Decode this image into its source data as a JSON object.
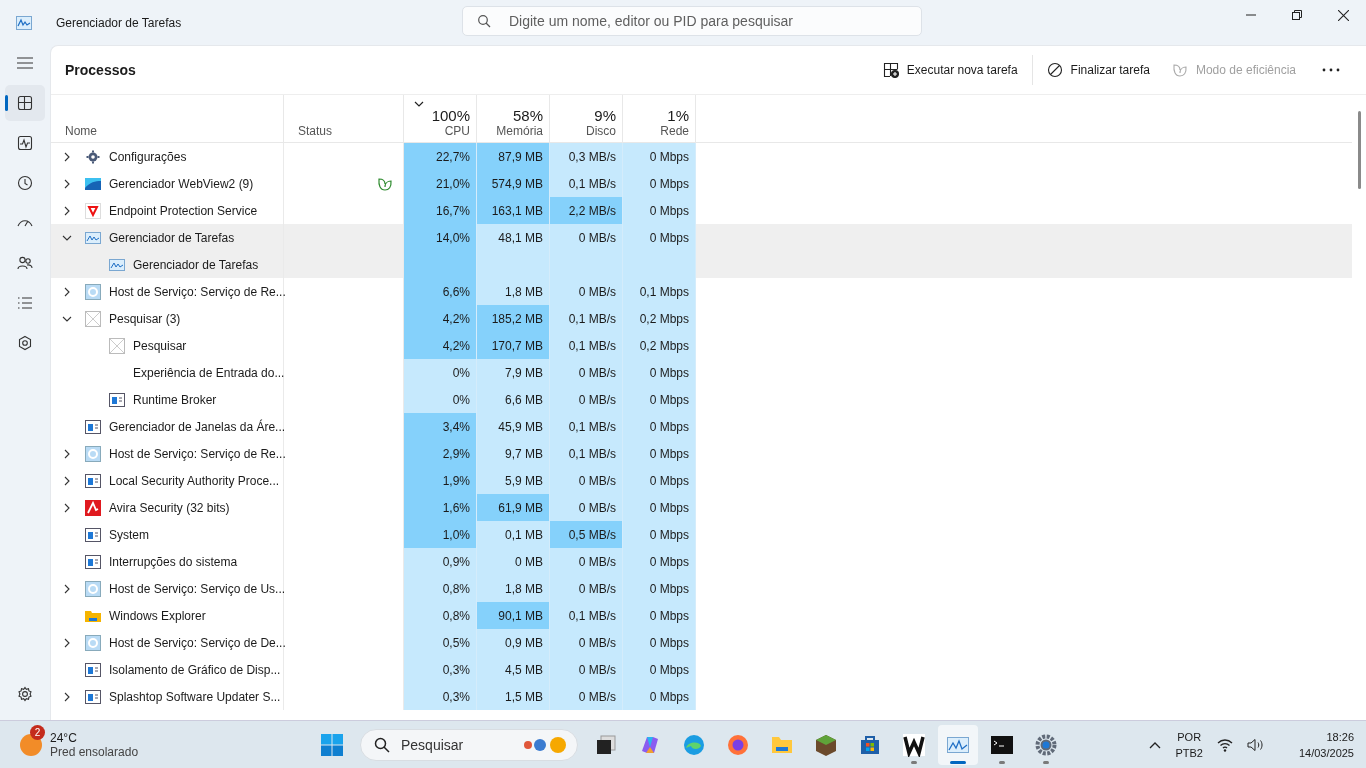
{
  "window": {
    "title": "Gerenciador de Tarefas"
  },
  "search": {
    "placeholder": "Digite um nome, editor ou PID para pesquisar"
  },
  "sidebar": {
    "items": [
      {
        "kind": "processes",
        "selected": true
      },
      {
        "kind": "performance",
        "selected": false
      },
      {
        "kind": "history",
        "selected": false
      },
      {
        "kind": "startup",
        "selected": false
      },
      {
        "kind": "users",
        "selected": false
      },
      {
        "kind": "details",
        "selected": false
      },
      {
        "kind": "services",
        "selected": false
      }
    ]
  },
  "page": {
    "title": "Processos"
  },
  "toolbar": [
    {
      "kind": "run",
      "label": "Executar nova tarefa",
      "disabled": false
    },
    {
      "kind": "end",
      "label": "Finalizar tarefa",
      "disabled": false
    },
    {
      "kind": "eco",
      "label": "Modo de eficiência",
      "disabled": true
    }
  ],
  "columns": [
    {
      "label": "Nome",
      "sorted": false
    },
    {
      "label": "Status",
      "sorted": false
    },
    {
      "total": "100%",
      "label": "CPU",
      "sorted": true
    },
    {
      "total": "58%",
      "label": "Memória",
      "sorted": false
    },
    {
      "total": "9%",
      "label": "Disco",
      "sorted": false
    },
    {
      "total": "1%",
      "label": "Rede",
      "sorted": false
    }
  ],
  "processes": [
    {
      "name": "Configurações",
      "kind": "settings",
      "expanded": false,
      "selected": false,
      "cpu": {
        "text": "22,7%",
        "high": true
      },
      "memory": {
        "text": "87,9 MB",
        "high": true
      },
      "disk": {
        "text": "0,3 MB/s",
        "high": false
      },
      "network": {
        "text": "0 Mbps",
        "high": false
      }
    },
    {
      "name": "Gerenciador WebView2 (9)",
      "kind": "webview",
      "expanded": false,
      "selected": false,
      "efficiency": true,
      "cpu": {
        "text": "21,0%",
        "high": true
      },
      "memory": {
        "text": "574,9 MB",
        "high": true
      },
      "disk": {
        "text": "0,1 MB/s",
        "high": false
      },
      "network": {
        "text": "0 Mbps",
        "high": false
      }
    },
    {
      "name": "Endpoint Protection Service",
      "kind": "shield",
      "expanded": false,
      "selected": false,
      "cpu": {
        "text": "16,7%",
        "high": true
      },
      "memory": {
        "text": "163,1 MB",
        "high": true
      },
      "disk": {
        "text": "2,2 MB/s",
        "high": true
      },
      "network": {
        "text": "0 Mbps",
        "high": false
      }
    },
    {
      "name": "Gerenciador de Tarefas",
      "kind": "monitor",
      "expanded": true,
      "selected": true,
      "cpu": {
        "text": "14,0%",
        "high": true
      },
      "memory": {
        "text": "48,1 MB",
        "high": false
      },
      "disk": {
        "text": "0 MB/s",
        "high": false
      },
      "network": {
        "text": "0 Mbps",
        "high": false
      },
      "children": [
        {
          "name": "Gerenciador de Tarefas",
          "kind": "monitor",
          "selected": true,
          "cpu": {
            "high": true
          },
          "memory": {
            "high": false
          },
          "disk": {
            "high": false
          },
          "network": {
            "high": false
          }
        }
      ]
    },
    {
      "name": "Host de Serviço: Serviço de Re...",
      "kind": "service",
      "expanded": false,
      "selected": false,
      "cpu": {
        "text": "6,6%",
        "high": true
      },
      "memory": {
        "text": "1,8 MB",
        "high": false
      },
      "disk": {
        "text": "0 MB/s",
        "high": false
      },
      "network": {
        "text": "0,1 Mbps",
        "high": false
      }
    },
    {
      "name": "Pesquisar (3)",
      "kind": "search",
      "expanded": true,
      "selected": false,
      "cpu": {
        "text": "4,2%",
        "high": true
      },
      "memory": {
        "text": "185,2 MB",
        "high": true
      },
      "disk": {
        "text": "0,1 MB/s",
        "high": false
      },
      "network": {
        "text": "0,2 Mbps",
        "high": false
      },
      "children": [
        {
          "name": "Pesquisar",
          "kind": "search",
          "selected": false,
          "cpu": {
            "text": "4,2%",
            "high": true
          },
          "memory": {
            "text": "170,7 MB",
            "high": true
          },
          "disk": {
            "text": "0,1 MB/s",
            "high": false
          },
          "network": {
            "text": "0,2 Mbps",
            "high": false
          }
        },
        {
          "name": "Experiência de Entrada do...",
          "kind": "none",
          "selected": false,
          "cpu": {
            "text": "0%",
            "high": false
          },
          "memory": {
            "text": "7,9 MB",
            "high": false
          },
          "disk": {
            "text": "0 MB/s",
            "high": false
          },
          "network": {
            "text": "0 Mbps",
            "high": false
          }
        },
        {
          "name": "Runtime Broker",
          "kind": "window",
          "selected": false,
          "cpu": {
            "text": "0%",
            "high": false
          },
          "memory": {
            "text": "6,6 MB",
            "high": false
          },
          "disk": {
            "text": "0 MB/s",
            "high": false
          },
          "network": {
            "text": "0 Mbps",
            "high": false
          }
        }
      ]
    },
    {
      "name": "Gerenciador de Janelas da Áre...",
      "kind": "window",
      "selected": false,
      "cpu": {
        "text": "3,4%",
        "high": true
      },
      "memory": {
        "text": "45,9 MB",
        "high": false
      },
      "disk": {
        "text": "0,1 MB/s",
        "high": false
      },
      "network": {
        "text": "0 Mbps",
        "high": false
      }
    },
    {
      "name": "Host de Serviço: Serviço de Re...",
      "kind": "service",
      "expanded": false,
      "selected": false,
      "cpu": {
        "text": "2,9%",
        "high": true
      },
      "memory": {
        "text": "9,7 MB",
        "high": false
      },
      "disk": {
        "text": "0,1 MB/s",
        "high": false
      },
      "network": {
        "text": "0 Mbps",
        "high": false
      }
    },
    {
      "name": "Local Security Authority Proce...",
      "kind": "window",
      "expanded": false,
      "selected": false,
      "cpu": {
        "text": "1,9%",
        "high": true
      },
      "memory": {
        "text": "5,9 MB",
        "high": false
      },
      "disk": {
        "text": "0 MB/s",
        "high": false
      },
      "network": {
        "text": "0 Mbps",
        "high": false
      }
    },
    {
      "name": "Avira Security (32 bits)",
      "kind": "antivirus",
      "expanded": false,
      "selected": false,
      "cpu": {
        "text": "1,6%",
        "high": true
      },
      "memory": {
        "text": "61,9 MB",
        "high": true
      },
      "disk": {
        "text": "0 MB/s",
        "high": false
      },
      "network": {
        "text": "0 Mbps",
        "high": false
      }
    },
    {
      "name": "System",
      "kind": "window",
      "selected": false,
      "cpu": {
        "text": "1,0%",
        "high": true
      },
      "memory": {
        "text": "0,1 MB",
        "high": false
      },
      "disk": {
        "text": "0,5 MB/s",
        "high": true
      },
      "network": {
        "text": "0 Mbps",
        "high": false
      }
    },
    {
      "name": "Interrupções do sistema",
      "kind": "window",
      "selected": false,
      "cpu": {
        "text": "0,9%",
        "high": false
      },
      "memory": {
        "text": "0 MB",
        "high": false
      },
      "disk": {
        "text": "0 MB/s",
        "high": false
      },
      "network": {
        "text": "0 Mbps",
        "high": false
      }
    },
    {
      "name": "Host de Serviço: Serviço de Us...",
      "kind": "service",
      "expanded": false,
      "selected": false,
      "cpu": {
        "text": "0,8%",
        "high": false
      },
      "memory": {
        "text": "1,8 MB",
        "high": false
      },
      "disk": {
        "text": "0 MB/s",
        "high": false
      },
      "network": {
        "text": "0 Mbps",
        "high": false
      }
    },
    {
      "name": "Windows Explorer",
      "kind": "folder",
      "selected": false,
      "cpu": {
        "text": "0,8%",
        "high": false
      },
      "memory": {
        "text": "90,1 MB",
        "high": true
      },
      "disk": {
        "text": "0,1 MB/s",
        "high": false
      },
      "network": {
        "text": "0 Mbps",
        "high": false
      }
    },
    {
      "name": "Host de Serviço: Serviço de De...",
      "kind": "service",
      "expanded": false,
      "selected": false,
      "cpu": {
        "text": "0,5%",
        "high": false
      },
      "memory": {
        "text": "0,9 MB",
        "high": false
      },
      "disk": {
        "text": "0 MB/s",
        "high": false
      },
      "network": {
        "text": "0 Mbps",
        "high": false
      }
    },
    {
      "name": "Isolamento de Gráfico de Disp...",
      "kind": "window",
      "selected": false,
      "cpu": {
        "text": "0,3%",
        "high": false
      },
      "memory": {
        "text": "4,5 MB",
        "high": false
      },
      "disk": {
        "text": "0 MB/s",
        "high": false
      },
      "network": {
        "text": "0 Mbps",
        "high": false
      }
    },
    {
      "name": "Splashtop Software Updater S...",
      "kind": "window",
      "expanded": false,
      "selected": false,
      "cpu": {
        "text": "0,3%",
        "high": false
      },
      "memory": {
        "text": "1,5 MB",
        "high": false
      },
      "disk": {
        "text": "0 MB/s",
        "high": false
      },
      "network": {
        "text": "0 Mbps",
        "high": false
      }
    }
  ],
  "taskbar": {
    "weather": {
      "temperature": "24°C",
      "description": "Pred ensolarado",
      "badge": "2"
    },
    "search": {
      "placeholder": "Pesquisar"
    },
    "apps": [
      {
        "kind": "start",
        "running": false,
        "selected": false
      },
      {
        "kind": "taskview",
        "running": false,
        "selected": false
      },
      {
        "kind": "copilot",
        "running": false,
        "selected": false
      },
      {
        "kind": "edge",
        "running": false,
        "selected": false
      },
      {
        "kind": "firefox",
        "running": false,
        "selected": false
      },
      {
        "kind": "files",
        "running": false,
        "selected": false
      },
      {
        "kind": "minecraft",
        "running": false,
        "selected": false
      },
      {
        "kind": "store",
        "running": false,
        "selected": false
      },
      {
        "kind": "wapp",
        "running": true,
        "selected": false
      },
      {
        "kind": "taskmgr",
        "running": true,
        "selected": true
      },
      {
        "kind": "terminal",
        "running": true,
        "selected": false
      },
      {
        "kind": "settings",
        "running": true,
        "selected": false
      }
    ],
    "language": "POR",
    "layout": "PTB2",
    "time": "18:26",
    "date": "14/03/2025"
  }
}
